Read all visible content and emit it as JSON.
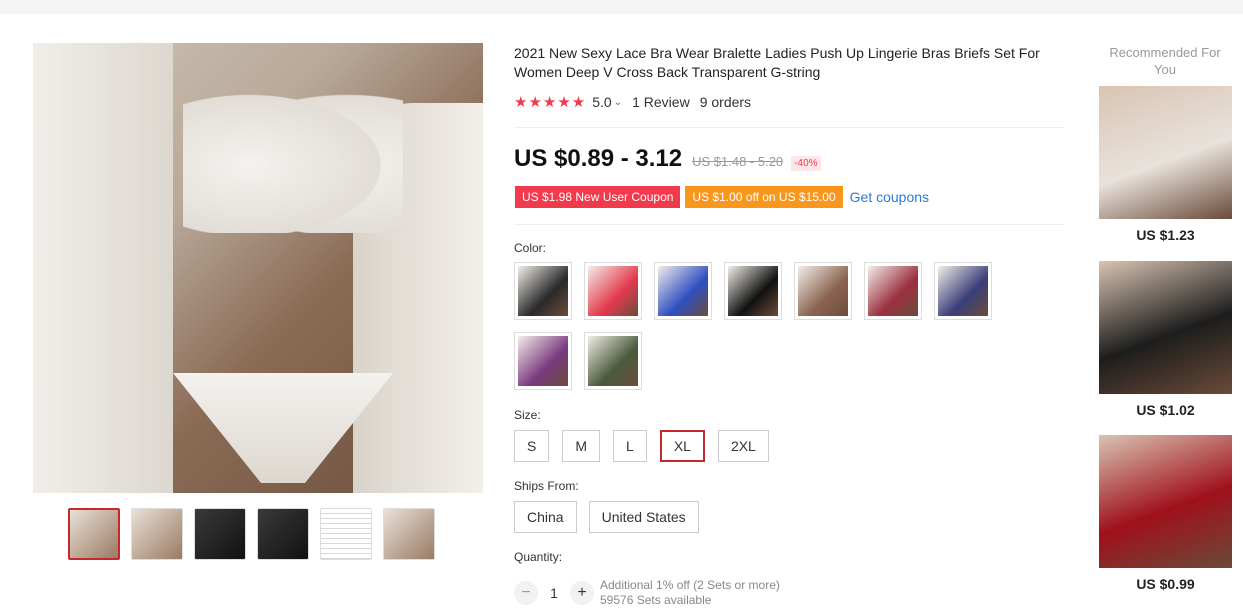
{
  "product": {
    "title": "2021 New Sexy Lace Bra Wear Bralette Ladies Push Up Lingerie Bras Briefs Set For Women Deep V Cross Back Transparent G-string",
    "stars": "★★★★★",
    "rating": "5.0",
    "reviews": "1 Review",
    "orders": "9 orders",
    "price": "US $0.89 - 3.12",
    "old_price": "US $1.48 - 5.20",
    "discount": "-40%"
  },
  "coupons": {
    "new_user": "US $1.98 New User Coupon",
    "off": "US $1.00 off on US $15.00",
    "get": "Get coupons"
  },
  "color": {
    "label": "Color:",
    "swatch_colors": [
      "#2a2a2a",
      "#e23a4d",
      "#2d4fc0",
      "#111111",
      "#8a6450",
      "#9a3040",
      "#3a3f7a",
      "#7a3a80",
      "#4a5a3a"
    ]
  },
  "size": {
    "label": "Size:",
    "options": [
      "S",
      "M",
      "L",
      "XL",
      "2XL"
    ],
    "selected": "XL"
  },
  "ships_from": {
    "label": "Ships From:",
    "options": [
      "China",
      "United States"
    ]
  },
  "quantity": {
    "label": "Quantity:",
    "value": "1",
    "minus": "−",
    "plus": "+",
    "additional": "Additional 1% off (2 Sets or more)",
    "available": "59576 Sets available"
  },
  "recommended": {
    "title": "Recommended For You",
    "items": [
      {
        "price": "US $1.23",
        "color": "#e8e2dc"
      },
      {
        "price": "US $1.02",
        "color": "#1d1d1d"
      },
      {
        "price": "US $0.99",
        "color": "#a0101c"
      }
    ]
  }
}
